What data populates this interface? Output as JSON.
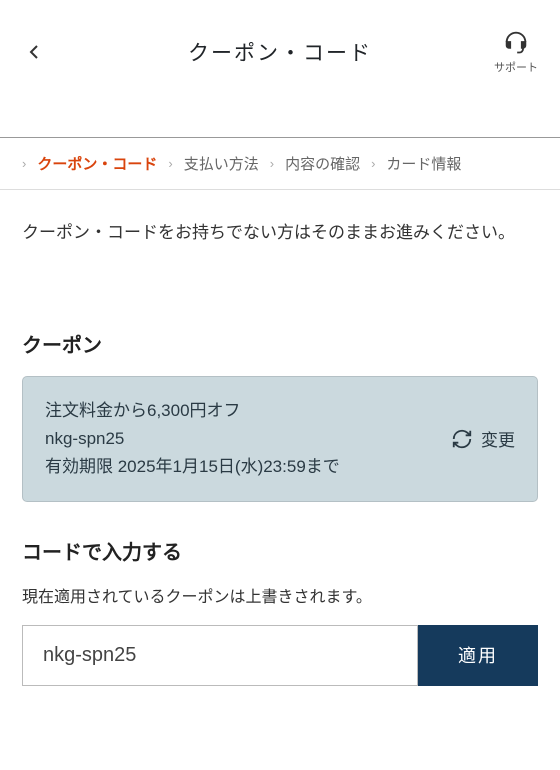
{
  "header": {
    "title": "クーポン・コード",
    "support_label": "サポート"
  },
  "steps": {
    "items": [
      "クーポン・コード",
      "支払い方法",
      "内容の確認",
      "カード情報"
    ],
    "active_index": 0
  },
  "description": "クーポン・コードをお持ちでない方はそのままお進みください。",
  "coupon_section": {
    "title": "クーポン",
    "discount_line": "注文料金から6,300円オフ",
    "code": "nkg-spn25",
    "expiry_line": "有効期限 2025年1月15日(水)23:59まで",
    "change_label": "変更"
  },
  "code_input_section": {
    "title": "コードで入力する",
    "overwrite_note": "現在適用されているクーポンは上書きされます。",
    "input_value": "nkg-spn25",
    "apply_label": "適用"
  }
}
